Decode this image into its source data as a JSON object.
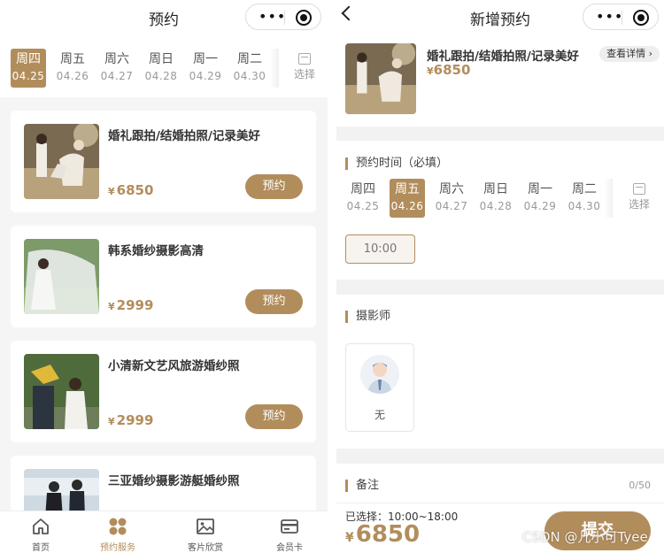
{
  "left": {
    "nav_title": "预约",
    "dates": [
      {
        "week": "周四",
        "date": "04.25",
        "active": true
      },
      {
        "week": "周五",
        "date": "04.26"
      },
      {
        "week": "周六",
        "date": "04.27"
      },
      {
        "week": "周日",
        "date": "04.28"
      },
      {
        "week": "周一",
        "date": "04.29"
      },
      {
        "week": "周二",
        "date": "04.30"
      }
    ],
    "pick_label": "选择",
    "currency": "¥",
    "book_label": "预约",
    "products": [
      {
        "name": "婚礼跟拍/结婚拍照/记录美好",
        "price": "6850"
      },
      {
        "name": "韩系婚纱摄影高清",
        "price": "2999"
      },
      {
        "name": "小清新文艺风旅游婚纱照",
        "price": "2999"
      },
      {
        "name": "三亚婚纱摄影游艇婚纱照",
        "price": ""
      }
    ],
    "tabs": [
      {
        "label": "首页",
        "icon": "home-icon"
      },
      {
        "label": "预约服务",
        "icon": "services-icon",
        "active": true
      },
      {
        "label": "客片欣赏",
        "icon": "image-icon"
      },
      {
        "label": "会员卡",
        "icon": "card-icon"
      }
    ]
  },
  "right": {
    "nav_title": "新增预约",
    "product_name": "婚礼跟拍/结婚拍照/记录美好",
    "product_price": "6850",
    "detail_link": "查看详情",
    "time_title": "预约时间（必填）",
    "dates": [
      {
        "week": "周四",
        "date": "04.25"
      },
      {
        "week": "周五",
        "date": "04.26",
        "active": true
      },
      {
        "week": "周六",
        "date": "04.27"
      },
      {
        "week": "周日",
        "date": "04.28"
      },
      {
        "week": "周一",
        "date": "04.29"
      },
      {
        "week": "周二",
        "date": "04.30"
      }
    ],
    "time_slot": "10:00",
    "photographer_title": "摄影师",
    "photographer_name": "无",
    "remark_title": "备注",
    "remark_count": "0/50",
    "selected_text": "已选择：10:00~18:00",
    "total_price": "6850",
    "submit_label": "提交"
  },
  "watermark": "CSDN @儿小可Tyee",
  "colors": {
    "accent": "#b28d5c",
    "bg": "#f5f5f5"
  }
}
